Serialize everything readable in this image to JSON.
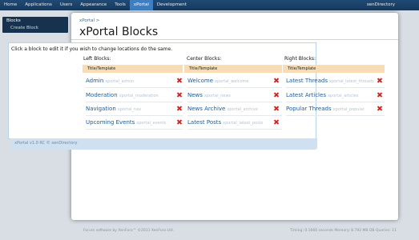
{
  "nav": {
    "tabs": [
      "Home",
      "Applications",
      "Users",
      "Appearance",
      "Tools",
      "xPortal",
      "Development"
    ],
    "active": "xPortal",
    "board_name": "xenDirectory"
  },
  "sidebar": {
    "title": "Blocks",
    "link": "Create Block"
  },
  "breadcrumb": "xPortal >",
  "page_title": "xPortal Blocks",
  "instruction": "Click a block to edit it if you wish to change locations do the same.",
  "columns": [
    {
      "title": "Left Blocks:",
      "sub": "Title/Template",
      "rows": [
        {
          "name": "Admin",
          "tpl": "xportal_admin"
        },
        {
          "name": "Moderation",
          "tpl": "xportal_moderation"
        },
        {
          "name": "Navigation",
          "tpl": "xportal_nav"
        },
        {
          "name": "Upcoming Events",
          "tpl": "xportal_events"
        }
      ]
    },
    {
      "title": "Center Blocks:",
      "sub": "Title/Template",
      "rows": [
        {
          "name": "Welcome",
          "tpl": "xportal_welcome"
        },
        {
          "name": "News",
          "tpl": "xportal_news"
        },
        {
          "name": "News Archive",
          "tpl": "xportal_archive"
        },
        {
          "name": "Latest Posts",
          "tpl": "xportal_latest_posts"
        }
      ]
    },
    {
      "title": "Right Blocks:",
      "sub": "Title/Template",
      "rows": [
        {
          "name": "Latest Threads",
          "tpl": "xportal_latest_threads"
        },
        {
          "name": "Latest Articles",
          "tpl": "xportal_articles"
        },
        {
          "name": "Popular Threads",
          "tpl": "xportal_popular"
        }
      ]
    }
  ],
  "version": "xPortal v1.0 RC © xenDirectory",
  "footer": {
    "left": "Forum software by XenForo™ ©2011 XenForo Ltd.",
    "right": "Timing: 0.1666 seconds Memory: 8.792 MB DB Queries: 11"
  },
  "colors": {
    "nav_bg": "#1f4a76",
    "nav_active": "#3f7fc1",
    "link": "#1e5b94",
    "header_row": "#f8ddb4",
    "delete": "#d12525"
  }
}
